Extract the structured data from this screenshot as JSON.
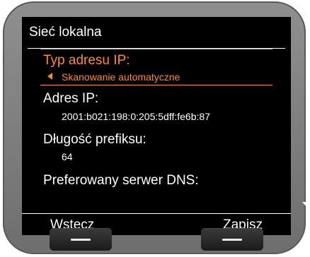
{
  "screen": {
    "title": "Sieć lokalna",
    "fields": [
      {
        "label": "Typ adresu IP:",
        "value": "Skanowanie automatyczne",
        "selected": true
      },
      {
        "label": "Adres IP:",
        "value": "2001:b021:198:0:205:5dff:fe6b:87"
      },
      {
        "label": "Długość prefiksu:",
        "value": "64"
      },
      {
        "label": "Preferowany serwer DNS:",
        "value": ""
      }
    ],
    "icons": {
      "selector_left": "arrow-left-icon",
      "scroll_down": "scroll-down-icon"
    }
  },
  "softkeys": {
    "left_label": "Wstecz",
    "right_label": "Zapisz"
  },
  "colors": {
    "selection": "#ff8a22",
    "text": "#ffffff",
    "screen_bg": "#000000",
    "device_bg": "#7d7d7d"
  }
}
